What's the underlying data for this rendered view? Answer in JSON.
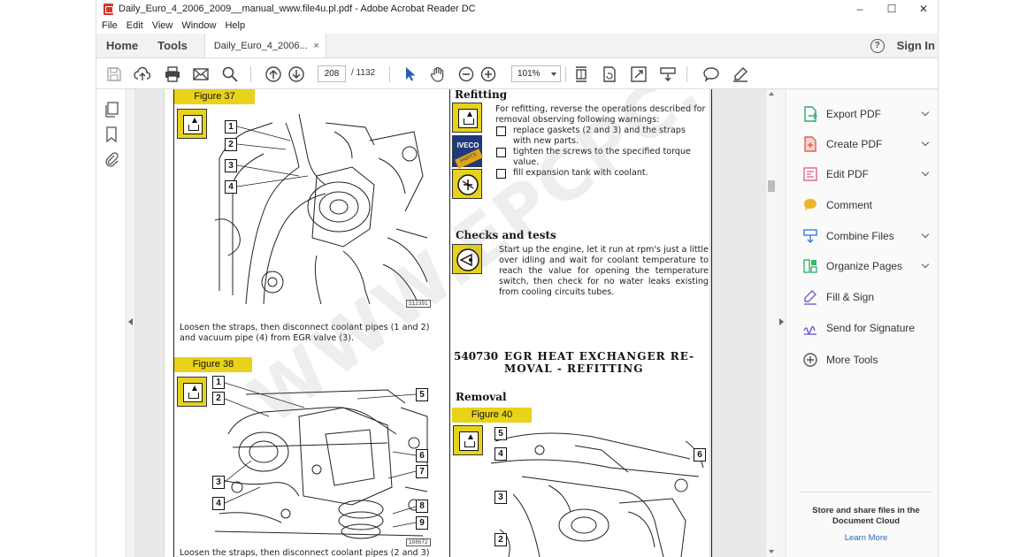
{
  "window": {
    "title": "Daily_Euro_4_2006_2009__manual_www.file4u.pl.pdf - Adobe Acrobat Reader DC",
    "controls": [
      "–",
      "☐",
      "✕"
    ]
  },
  "menu": [
    "File",
    "Edit",
    "View",
    "Window",
    "Help"
  ],
  "tabs": {
    "home": "Home",
    "tools": "Tools",
    "document": "Daily_Euro_4_2006...",
    "close": "×",
    "help": "?",
    "signin": "Sign In"
  },
  "toolbar": {
    "page_current": "208",
    "page_total": "/ 1132",
    "zoom": "101%"
  },
  "document": {
    "left": {
      "figure37": "Figure 37",
      "caption37": "Loosen the straps, then disconnect coolant pipes (1 and 2) and vacuum pipe (4) from EGR valve (3).",
      "code37": "112391",
      "figure38": "Figure 38",
      "code38": "108672",
      "caption38": "Loosen the straps, then disconnect coolant pipes (2 and 3)",
      "callouts37": [
        "1",
        "2",
        "3",
        "4"
      ],
      "callouts38": [
        "1",
        "2",
        "3",
        "4",
        "5",
        "6",
        "7",
        "8",
        "9"
      ]
    },
    "right": {
      "refitting_title": "Refitting",
      "refitting_intro": "For refitting, reverse the operations described for removal observing following warnings:",
      "bullets": [
        "replace gaskets (2 and 3) and the straps with new parts.",
        "tighten the screws to the specified torque value.",
        "fill expansion tank with coolant."
      ],
      "iveco_label": "IVECO",
      "iveco_sub": "PARTS",
      "checks_title": "Checks and tests",
      "checks_text": "Start up the engine, let it run at rpm's just a little over idling and wait for coolant temperature to reach the value for opening the temperature switch, then check for no water leaks existing from cooling circuits tubes.",
      "section_code": "540730",
      "section_title_1": "EGR HEAT EXCHANGER RE-",
      "section_title_2": "MOVAL - REFITTING",
      "removal_title": "Removal",
      "figure40": "Figure 40",
      "callouts40": [
        "5",
        "4",
        "6",
        "3",
        "2"
      ]
    },
    "watermark": "WWW.EPCPC.COM"
  },
  "right_panel": {
    "items": [
      {
        "label": "Export PDF",
        "icon": "export-pdf-icon",
        "color": "#2eaa6b",
        "chevron": true
      },
      {
        "label": "Create PDF",
        "icon": "create-pdf-icon",
        "color": "#e0614f",
        "chevron": true
      },
      {
        "label": "Edit PDF",
        "icon": "edit-pdf-icon",
        "color": "#e2628f",
        "chevron": true
      },
      {
        "label": "Comment",
        "icon": "comment-icon",
        "color": "#f0b428",
        "chevron": false
      },
      {
        "label": "Combine Files",
        "icon": "combine-files-icon",
        "color": "#3a7be0",
        "chevron": true
      },
      {
        "label": "Organize Pages",
        "icon": "organize-pages-icon",
        "color": "#3ab66e",
        "chevron": true
      },
      {
        "label": "Fill & Sign",
        "icon": "fill-sign-icon",
        "color": "#7b5ec9",
        "chevron": false
      },
      {
        "label": "Send for Signature",
        "icon": "send-signature-icon",
        "color": "#6a5acd",
        "chevron": false
      },
      {
        "label": "More Tools",
        "icon": "more-tools-icon",
        "color": "#555555",
        "chevron": false
      }
    ],
    "cloud_text": "Store and share files in the Document Cloud",
    "learn_more": "Learn More"
  }
}
